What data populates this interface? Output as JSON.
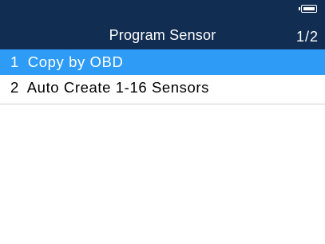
{
  "header": {
    "title": "Program Sensor",
    "page_indicator": "1/2",
    "battery_icon": "battery-full-icon",
    "background_color": "#122d52"
  },
  "menu": {
    "selected_color": "#2e9cf6",
    "items": [
      {
        "number": "1",
        "label": "Copy by OBD",
        "selected": true
      },
      {
        "number": "2",
        "label": "Auto Create 1-16 Sensors",
        "selected": false
      }
    ]
  }
}
